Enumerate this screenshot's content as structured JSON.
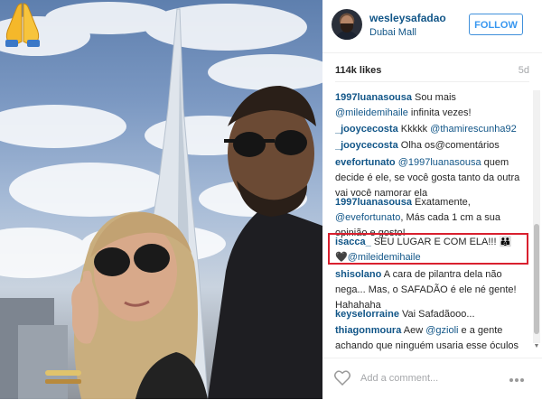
{
  "post": {
    "emoji": "🙏",
    "icons": {
      "emoji": "folded-hands-icon",
      "heart": "heart-icon",
      "more": "more-options-icon"
    }
  },
  "header": {
    "username": "wesleysafadao",
    "location": "Dubai Mall",
    "follow_label": "FOLLOW"
  },
  "stats": {
    "likes": "114k likes",
    "time_ago": "5d"
  },
  "comments": [
    {
      "user": "1997luanasousa",
      "text": " Sou mais ",
      "mention": "@mileidemihaile",
      "after": " infinita vezes!"
    },
    {
      "user": "_jooycecosta",
      "text": " Kkkkk ",
      "mention": "@thamirescunha92",
      "after": ""
    },
    {
      "user": "_jooycecosta",
      "text": " Olha os@comentários",
      "mention": "",
      "after": ""
    },
    {
      "user": "evefortunato",
      "text": " ",
      "mention": "@1997luanasousa",
      "after": " quem decide é ele, se você gosta tanto da outra vai você namorar ela"
    },
    {
      "user": "1997luanasousa",
      "text": " Exatamente, ",
      "mention": "@evefortunato",
      "after": ", Más cada 1 cm a sua opinião e gosto!"
    },
    {
      "user": "isacca_",
      "text": " SEU LUGAR E COM ELA!!! 👪 🖤",
      "mention": "@mileidemihaile",
      "after": ""
    },
    {
      "user": "shisolano",
      "text": " A cara de pilantra dela não nega... Mas, o SAFADÃO é ele né gente! Hahahaha",
      "mention": "",
      "after": ""
    },
    {
      "user": "keyselorraine",
      "text": " Vai Safadãooo...",
      "mention": "",
      "after": ""
    },
    {
      "user": "thiagonmoura",
      "text": " Aew ",
      "mention": "@gzioli",
      "after": " e a gente achando que ninguém usaria esse óculos ridículo"
    }
  ],
  "footer": {
    "placeholder": "Add a comment..."
  },
  "colors": {
    "link": "#125688",
    "follow_border": "#4090db",
    "highlight": "#d9202f"
  }
}
